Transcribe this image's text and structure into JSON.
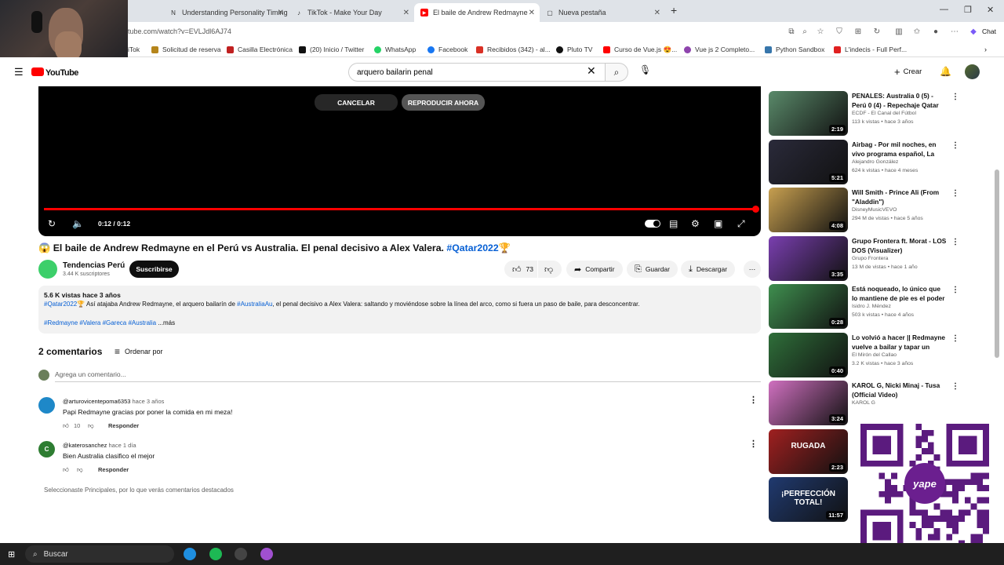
{
  "browser": {
    "tabs": [
      {
        "title": "Understanding Personality Timing",
        "icon": "notion-icon"
      },
      {
        "title": "TikTok - Make Your Day",
        "icon": "tiktok-icon"
      },
      {
        "title": "El baile de Andrew Redmayne",
        "icon": "youtube-icon",
        "active": true
      },
      {
        "title": "Nueva pestaña",
        "icon": "newtab-icon"
      }
    ],
    "new_tab": "+",
    "url": "tube.com/watch?v=EVLJdl6AJ74",
    "bookmarks": [
      {
        "label": "iTok"
      },
      {
        "label": "Solicitud de reserva"
      },
      {
        "label": "Casilla Electrónica"
      },
      {
        "label": "(20) Inicio / Twitter"
      },
      {
        "label": "WhatsApp"
      },
      {
        "label": "Facebook"
      },
      {
        "label": "Recibidos (342) - al..."
      },
      {
        "label": "Pluto TV"
      },
      {
        "label": "Curso de Vue.js 😍..."
      },
      {
        "label": "Vue js 2 Completo..."
      },
      {
        "label": "Python Sandbox"
      },
      {
        "label": "L'indecis - Full Perf..."
      }
    ],
    "chat_label": "Chat"
  },
  "youtube": {
    "logo": "YouTube",
    "search_value": "arquero bailarin penal",
    "create_label": "Crear"
  },
  "player": {
    "cancel_label": "CANCELAR",
    "play_now_label": "REPRODUCIR AHORA",
    "time": "0:12 / 0:12",
    "progress": 1.0
  },
  "video": {
    "emoji": "😱",
    "title": "El baile de Andrew Redmayne en el Perú vs Australia. El penal decisivo a Alex Valera.",
    "hashtag": "#Qatar2022",
    "trophy": "🏆",
    "channel": "Tendencias Perú",
    "subscribers": "3.44 K suscriptores",
    "subscribe_label": "Suscribirse",
    "likes": "73",
    "share_label": "Compartir",
    "save_label": "Guardar",
    "download_label": "Descargar"
  },
  "description": {
    "stats": "5.6 K vistas  hace 3 años",
    "tag1": "#Qatar2022",
    "text_a": "🏆 Así atajaba Andrew Redmayne, el arquero bailarín de ",
    "tag2": "#AustraliaAu",
    "text_b": ", el penal decisivo a Alex Valera: saltando y moviéndose sobre la línea del arco, como si fuera un paso de baile, para desconcentrar.",
    "tags": "#Redmayne #Valera #Gareca #Australia",
    "more": "...más"
  },
  "comments": {
    "count_label": "2 comentarios",
    "sort_label": "Ordenar por",
    "add_placeholder": "Agrega un comentario...",
    "items": [
      {
        "author": "@arturovicentepoma6353",
        "time": "hace 3 años",
        "text": "Papi Redmayne gracias por poner la comida en mi meza!",
        "likes": "10",
        "reply": "Responder",
        "avatar_letter": ""
      },
      {
        "author": "@katerosanchez",
        "time": "hace 1 día",
        "text": "Bien Australia clasifico el mejor",
        "likes": "",
        "reply": "Responder",
        "avatar_letter": "C"
      }
    ],
    "note": "Seleccionaste Principales, por lo que verás comentarios destacados"
  },
  "recommendations": [
    {
      "title": "PENALES: Australia 0 (5) - Perú 0 (4) - Repechaje Qatar 2022",
      "channel": "ECDF - El Canal del Fútbol",
      "meta": "113 k vistas • hace 3 años",
      "duration": "2:19",
      "color": "#5a8a6a"
    },
    {
      "title": "Airbag - Por mil noches, en vivo programa español, La revuelta",
      "channel": "Alejandro González",
      "meta": "624 k vistas • hace 4 meses",
      "duration": "5:21",
      "color": "#2a2a3a"
    },
    {
      "title": "Will Smith - Prince Ali (From \"Aladdin\")",
      "channel": "DisneyMusicVEVO",
      "meta": "294 M de vistas • hace 5 años",
      "duration": "4:08",
      "color": "#c8a050"
    },
    {
      "title": "Grupo Frontera ft. Morat - LOS DOS (Visualizer)",
      "channel": "Grupo Frontera",
      "meta": "13 M de vistas • hace 1 año",
      "duration": "3:35",
      "color": "#7a3fb0"
    },
    {
      "title": "Está noqueado, lo único que lo mantiene de pie es el poder de...",
      "channel": "Isidro J. Méndez",
      "meta": "503 k vistas • hace 4 años",
      "duration": "0:28",
      "color": "#3f8f4f"
    },
    {
      "title": "Lo volvió a hacer || Redmayne vuelve a bailar y tapar un pena...",
      "channel": "El Mirón del Callao",
      "meta": "3.2 K vistas • hace 3 años",
      "duration": "0:40",
      "color": "#2f6f3a"
    },
    {
      "title": "KAROL G, Nicki Minaj - Tusa (Official Video)",
      "channel": "KAROL G",
      "meta": "",
      "duration": "3:24",
      "color": "#d070c0"
    },
    {
      "title": "",
      "channel": "",
      "meta": "",
      "duration": "2:23",
      "color": "#a02020",
      "overlay": "RUGADA"
    },
    {
      "title": "",
      "channel": "",
      "meta": "",
      "duration": "11:57",
      "color": "#203a70",
      "overlay": "¡PERFECCIÓN TOTAL!"
    }
  ],
  "qr": {
    "badge": "yape"
  },
  "taskbar": {
    "search_label": "Buscar"
  }
}
